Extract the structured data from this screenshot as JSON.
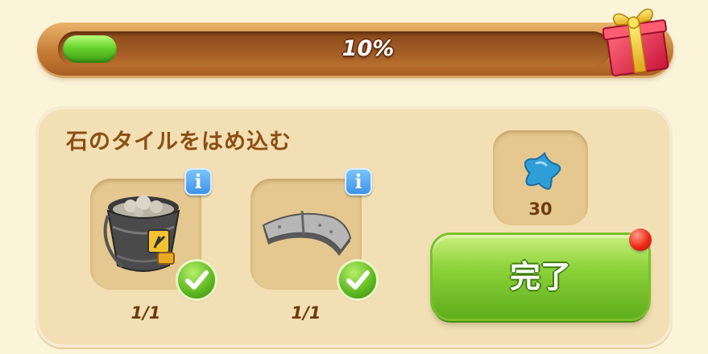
{
  "progress": {
    "percent": 10,
    "label": "10%"
  },
  "gift": {
    "icon": "gift-box-icon"
  },
  "task": {
    "title": "石のタイルをはめ込む",
    "requirements": [
      {
        "icon": "bucket-icon",
        "count": "1/1",
        "info_icon": "info-icon",
        "status_icon": "checkmark-icon"
      },
      {
        "icon": "stone-tile-icon",
        "count": "1/1",
        "info_icon": "info-icon",
        "status_icon": "checkmark-icon"
      }
    ],
    "reward": {
      "icon": "blue-star-icon",
      "value": "30"
    },
    "complete_button": {
      "label": "完了"
    }
  },
  "colors": {
    "title_text": "#8c4e12",
    "progress_fill": "#69d22d",
    "button_green": "#8cd23a",
    "notification_red": "#ec2a15",
    "info_blue": "#3a8fe6"
  }
}
